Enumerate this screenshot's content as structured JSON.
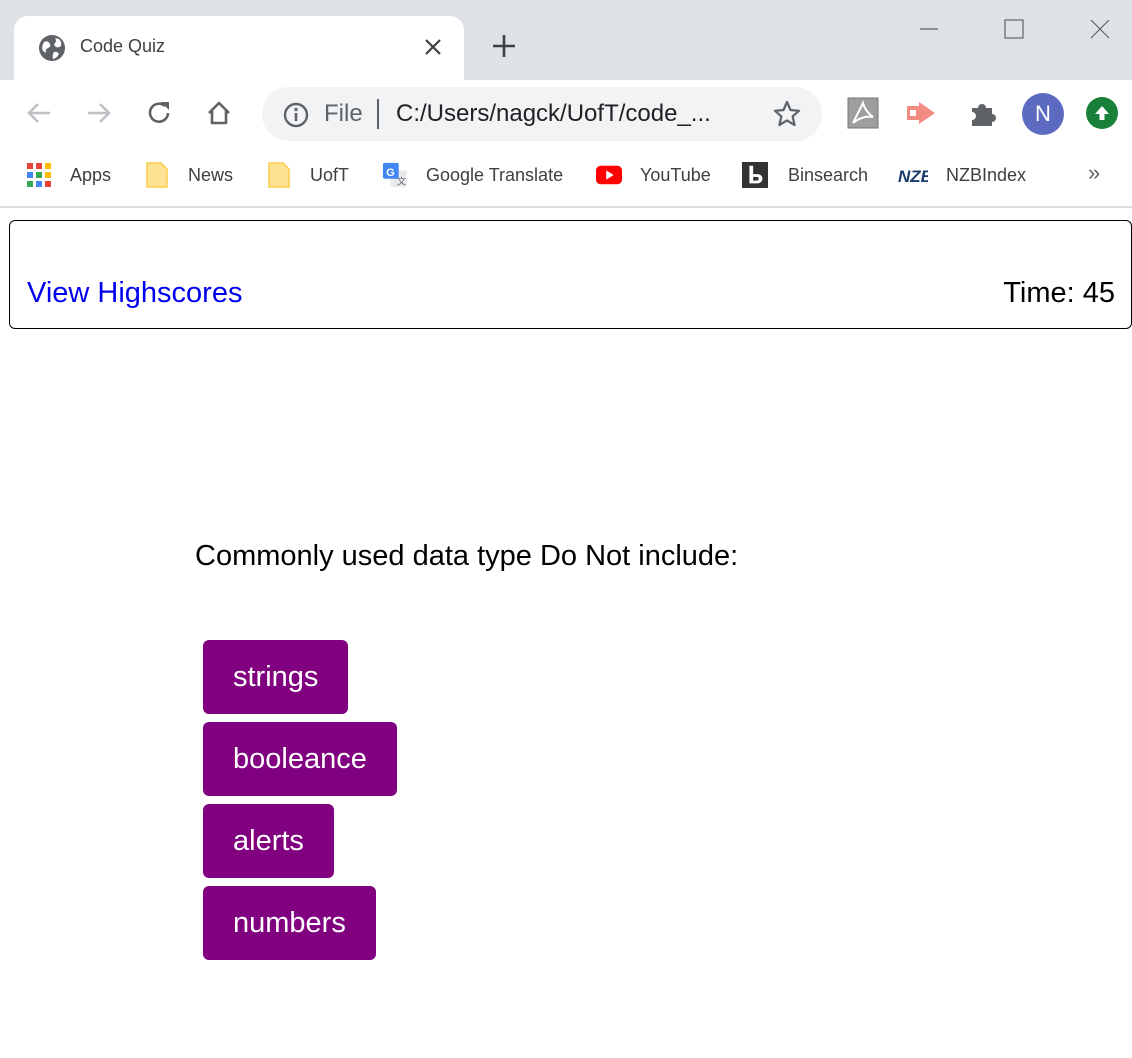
{
  "browser": {
    "tab": {
      "title": "Code Quiz"
    },
    "omnibox": {
      "scheme": "File",
      "url": "C:/Users/nagck/UofT/code_..."
    },
    "profile_initial": "N",
    "bookmarks": [
      {
        "label": "Apps",
        "icon": "apps-grid-icon"
      },
      {
        "label": "News",
        "icon": "folder-icon"
      },
      {
        "label": "UofT",
        "icon": "folder-icon"
      },
      {
        "label": "Google Translate",
        "icon": "google-translate-icon"
      },
      {
        "label": "YouTube",
        "icon": "youtube-icon"
      },
      {
        "label": "Binsearch",
        "icon": "binsearch-icon"
      },
      {
        "label": "NZBIndex",
        "icon": "nzbindex-icon"
      }
    ],
    "bookmarks_more": "»"
  },
  "page": {
    "header": {
      "highscores_link": "View Highscores",
      "timer": "Time: 45"
    },
    "question": "Commonly used data type Do Not include:",
    "answers": [
      "strings",
      "booleance",
      "alerts",
      "numbers"
    ],
    "colors": {
      "answer_button_bg": "#800080",
      "link": "#0000ee"
    }
  }
}
